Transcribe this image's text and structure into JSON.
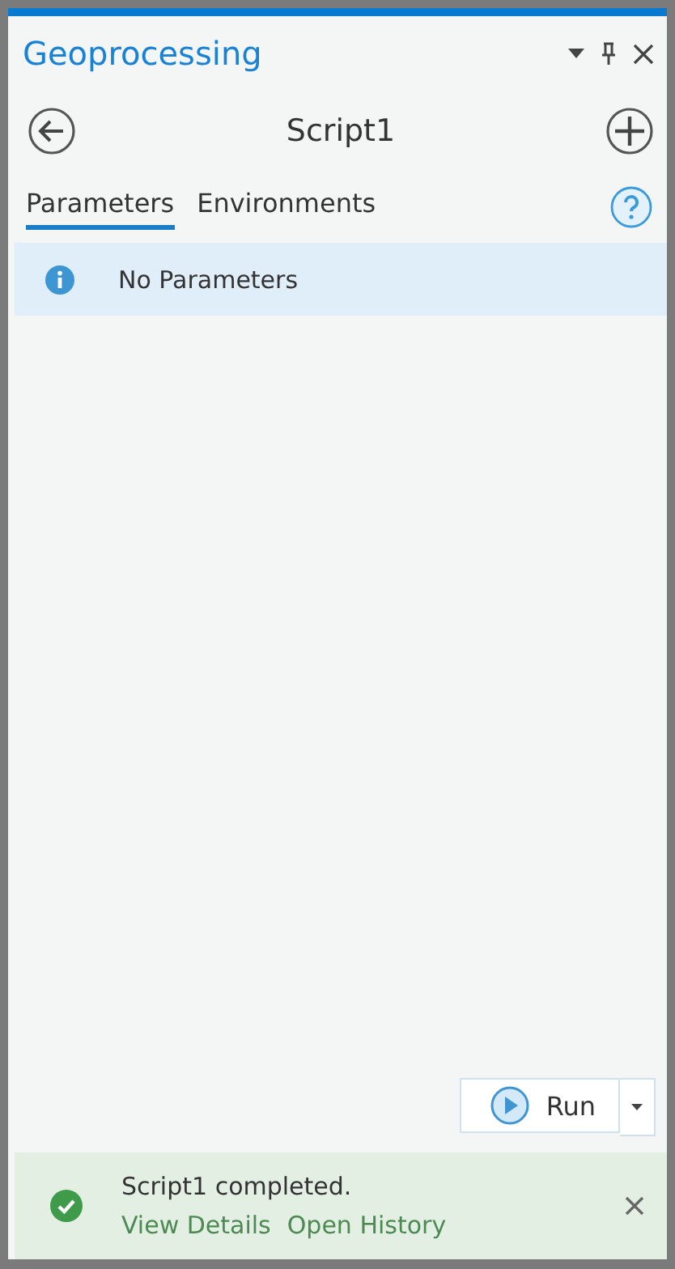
{
  "pane": {
    "title": "Geoprocessing"
  },
  "tool": {
    "title": "Script1"
  },
  "tabs": [
    {
      "label": "Parameters",
      "selected": true
    },
    {
      "label": "Environments",
      "selected": false
    }
  ],
  "message": {
    "text": "No Parameters"
  },
  "run_button": {
    "label": "Run"
  },
  "status": {
    "text": "Script1 completed.",
    "links": [
      "View Details",
      "Open History"
    ]
  }
}
